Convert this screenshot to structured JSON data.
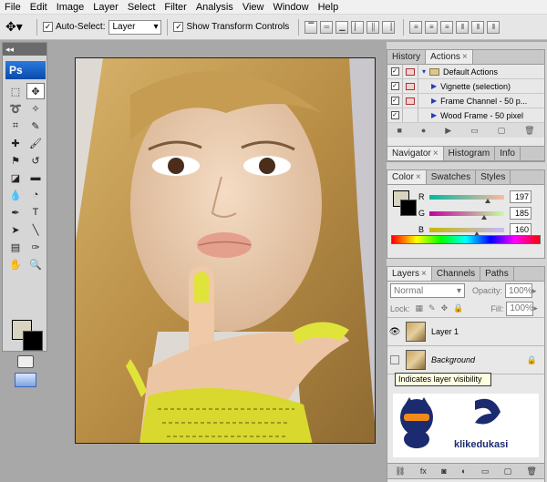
{
  "menu": [
    "File",
    "Edit",
    "Image",
    "Layer",
    "Select",
    "Filter",
    "Analysis",
    "View",
    "Window",
    "Help"
  ],
  "options": {
    "auto_select_label": "Auto-Select:",
    "auto_select_value": "Layer",
    "show_transform_label": "Show Transform Controls"
  },
  "toolbox": {
    "collapse": "◂◂",
    "logo": "Ps"
  },
  "history_panel": {
    "tabs": [
      "History",
      "Actions"
    ],
    "actions": [
      "Default Actions",
      "Vignette (selection)",
      "Frame Channel - 50 p...",
      "Wood Frame - 50 pixel"
    ]
  },
  "navigator_panel": {
    "tabs": [
      "Navigator",
      "Histogram",
      "Info"
    ]
  },
  "color_panel": {
    "tabs": [
      "Color",
      "Swatches",
      "Styles"
    ],
    "channels": [
      {
        "label": "R",
        "value": "197",
        "fraction": 0.77
      },
      {
        "label": "G",
        "value": "185",
        "fraction": 0.73
      },
      {
        "label": "B",
        "value": "160",
        "fraction": 0.63
      }
    ],
    "colors": {
      "foreground": "#d8d4c0",
      "background": "#000000"
    }
  },
  "layers_panel": {
    "tabs": [
      "Layers",
      "Channels",
      "Paths"
    ],
    "blend_mode": "Normal",
    "opacity_label": "Opacity:",
    "opacity_value": "100%",
    "lock_label": "Lock:",
    "fill_label": "Fill:",
    "fill_value": "100%",
    "layers": [
      "Layer 1",
      "Background"
    ],
    "tooltip": "Indicates layer visibility"
  },
  "watermark": "klikedukasi"
}
